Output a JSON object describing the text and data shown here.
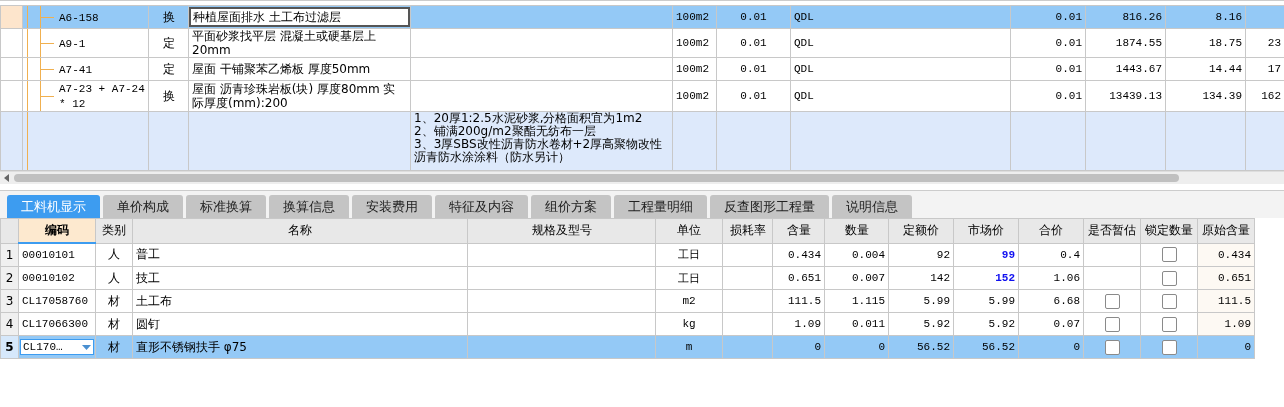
{
  "items_grid": {
    "rows": [
      {
        "kind": "item",
        "code": "A6-158",
        "type": "换",
        "name": "种植屋面排水 土工布过滤层",
        "column_6": "100m2",
        "column_7": "0.01",
        "column_8": "QDL",
        "column_9": "0.01",
        "column_10": "816.26",
        "column_11": "8.16",
        "selected": true
      },
      {
        "kind": "item",
        "code": "A9-1",
        "type": "定",
        "name": "平面砂浆找平层 混凝土或硬基层上20mm",
        "column_6": "100m2",
        "column_7": "0.01",
        "column_8": "QDL",
        "column_9": "0.01",
        "column_10": "1874.55",
        "column_11": "18.75",
        "column_12": "23",
        "selected": false
      },
      {
        "kind": "item",
        "code": "A7-41",
        "type": "定",
        "name": "屋面 干铺聚苯乙烯板 厚度50mm",
        "column_6": "100m2",
        "column_7": "0.01",
        "column_8": "QDL",
        "column_9": "0.01",
        "column_10": "1443.67",
        "column_11": "14.44",
        "column_12": "17",
        "selected": false
      },
      {
        "kind": "item",
        "code": "A7-23 + A7-24 * 12",
        "type": "换",
        "name": "屋面 沥青珍珠岩板(块) 厚度80mm  实际厚度(mm):200",
        "column_6": "100m2",
        "column_7": "0.01",
        "column_8": "QDL",
        "column_9": "0.01",
        "column_10": "13439.13",
        "column_11": "134.39",
        "column_12": "162",
        "selected": false
      },
      {
        "kind": "description",
        "feature_lines": [
          "1、20厚1:2.5水泥砂浆,分格面积宜为1m2",
          "2、铺满200g/m2聚酯无纺布一层",
          "3、3厚SBS改性沥青防水卷材+2厚高聚物改性沥青防水涂涂料（防水另计）"
        ],
        "selected": false
      }
    ]
  },
  "tabs": [
    {
      "label": "工料机显示",
      "selected": true
    },
    {
      "label": "单价构成",
      "selected": false
    },
    {
      "label": "标准换算",
      "selected": false
    },
    {
      "label": "换算信息",
      "selected": false
    },
    {
      "label": "安装费用",
      "selected": false
    },
    {
      "label": "特征及内容",
      "selected": false
    },
    {
      "label": "组价方案",
      "selected": false
    },
    {
      "label": "工程量明细",
      "selected": false
    },
    {
      "label": "反查图形工程量",
      "selected": false
    },
    {
      "label": "说明信息",
      "selected": false
    }
  ],
  "detail": {
    "columns": [
      {
        "label": "编码",
        "selected": true
      },
      {
        "label": "类别",
        "selected": false
      },
      {
        "label": "名称",
        "selected": false
      },
      {
        "label": "规格及型号",
        "selected": false
      },
      {
        "label": "单位",
        "selected": false
      },
      {
        "label": "损耗率",
        "selected": false
      },
      {
        "label": "含量",
        "selected": false
      },
      {
        "label": "数量",
        "selected": false
      },
      {
        "label": "定额价",
        "selected": false
      },
      {
        "label": "市场价",
        "selected": false
      },
      {
        "label": "合价",
        "selected": false
      },
      {
        "label": "是否暂估",
        "selected": false
      },
      {
        "label": "锁定数量",
        "selected": false
      },
      {
        "label": "原始含量",
        "selected": false
      }
    ],
    "rows": [
      {
        "index": "1",
        "code": "00010101",
        "type": "人",
        "name": "普工",
        "unit": "工日",
        "content": "0.434",
        "quantity": "0.004",
        "quota_price": "92",
        "market_price": "99",
        "market_price_changed": true,
        "total": "0.4",
        "locked": false,
        "original_content": "0.434",
        "selected": false
      },
      {
        "index": "2",
        "code": "00010102",
        "type": "人",
        "name": "技工",
        "unit": "工日",
        "content": "0.651",
        "quantity": "0.007",
        "quota_price": "142",
        "market_price": "152",
        "market_price_changed": true,
        "total": "1.06",
        "locked": false,
        "original_content": "0.651",
        "selected": false
      },
      {
        "index": "3",
        "code": "CL17058760",
        "type": "材",
        "name": "土工布",
        "unit": "m2",
        "content": "111.5",
        "quantity": "1.115",
        "quota_price": "5.99",
        "market_price": "5.99",
        "market_price_changed": false,
        "total": "6.68",
        "estimate": false,
        "locked": false,
        "original_content": "111.5",
        "selected": false
      },
      {
        "index": "4",
        "code": "CL17066300",
        "type": "材",
        "name": "圆钉",
        "unit": "kg",
        "content": "1.09",
        "quantity": "0.011",
        "quota_price": "5.92",
        "market_price": "5.92",
        "market_price_changed": false,
        "total": "0.07",
        "estimate": false,
        "locked": false,
        "original_content": "1.09",
        "selected": false
      },
      {
        "index": "5",
        "code": "CL170…",
        "type": "材",
        "name": "直形不锈钢扶手 φ75",
        "unit": "m",
        "content": "0",
        "quantity": "0",
        "quota_price": "56.52",
        "market_price": "56.52",
        "market_price_changed": false,
        "total": "0",
        "estimate": false,
        "locked": false,
        "original_content": "0",
        "selected": true
      }
    ]
  }
}
